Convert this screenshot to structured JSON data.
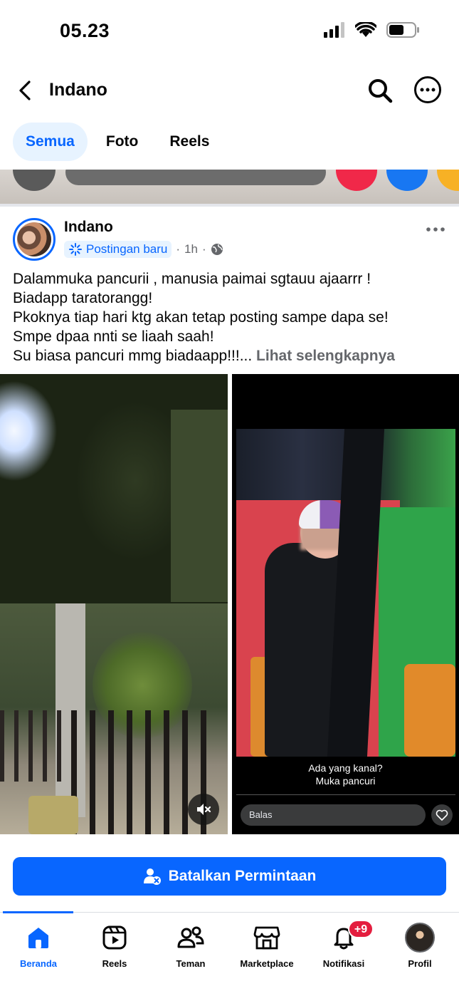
{
  "status_bar": {
    "time": "05.23"
  },
  "header": {
    "title": "Indano"
  },
  "tabs": [
    {
      "label": "Semua",
      "active": true
    },
    {
      "label": "Foto",
      "active": false
    },
    {
      "label": "Reels",
      "active": false
    }
  ],
  "post": {
    "author": "Indano",
    "badge": "Postingan baru",
    "time": "1h",
    "text_lines": [
      "Dalammuka pancurii , manusia paimai sgtauu ajaarrr !",
      "Biadapp taratorangg!",
      "Pkoknya tiap hari ktg akan tetap posting sampe dapa se!",
      "Smpe dpaa nnti se liaah saah!",
      "Su biasa pancuri mmg biadaapp!!!..."
    ],
    "see_more": "Lihat selengkapnya",
    "story_caption": [
      "Ada yang kanal?",
      "Muka pancuri"
    ],
    "reply_placeholder": "Balas"
  },
  "action_button": "Batalkan Permintaan",
  "bottom_nav": [
    {
      "label": "Beranda",
      "icon": "home-icon",
      "active": true
    },
    {
      "label": "Reels",
      "icon": "reels-icon",
      "active": false
    },
    {
      "label": "Teman",
      "icon": "friends-icon",
      "active": false
    },
    {
      "label": "Marketplace",
      "icon": "marketplace-icon",
      "active": false
    },
    {
      "label": "Notifikasi",
      "icon": "bell-icon",
      "active": false,
      "badge": "+9"
    },
    {
      "label": "Profil",
      "icon": "profile-avatar",
      "active": false
    }
  ],
  "colors": {
    "accent": "#0866ff",
    "badge": "#e41e3f",
    "text": "#050505",
    "muted": "#65676b"
  }
}
